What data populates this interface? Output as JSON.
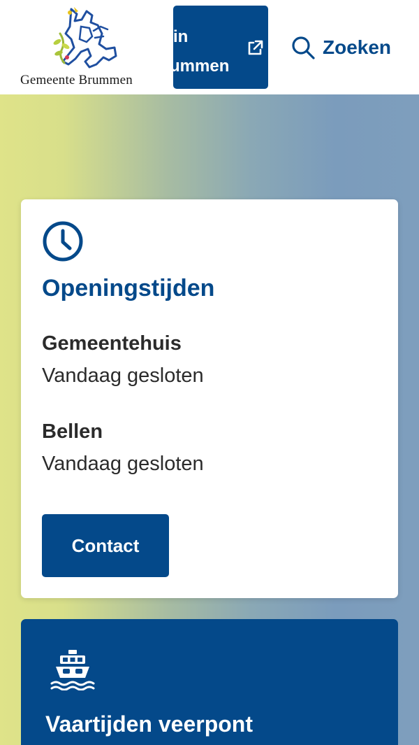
{
  "header": {
    "logo_text": "Gemeente Brummen",
    "external_button": {
      "line1": "in",
      "line2": "ummen"
    },
    "search_label": "Zoeken"
  },
  "opening_hours": {
    "title": "Openingstijden",
    "items": [
      {
        "label": "Gemeentehuis",
        "value": "Vandaag gesloten"
      },
      {
        "label": "Bellen",
        "value": "Vandaag gesloten"
      }
    ],
    "contact_label": "Contact"
  },
  "ferry": {
    "title": "Vaartijden veerpont"
  },
  "colors": {
    "primary": "#04498a",
    "gradient_left": "#dfe389",
    "gradient_right": "#7e9ebd"
  },
  "icons": {
    "logo": "lion-crest-logo",
    "external": "external-link-icon",
    "search": "search-icon",
    "clock": "clock-icon",
    "ferry": "ferry-icon"
  }
}
